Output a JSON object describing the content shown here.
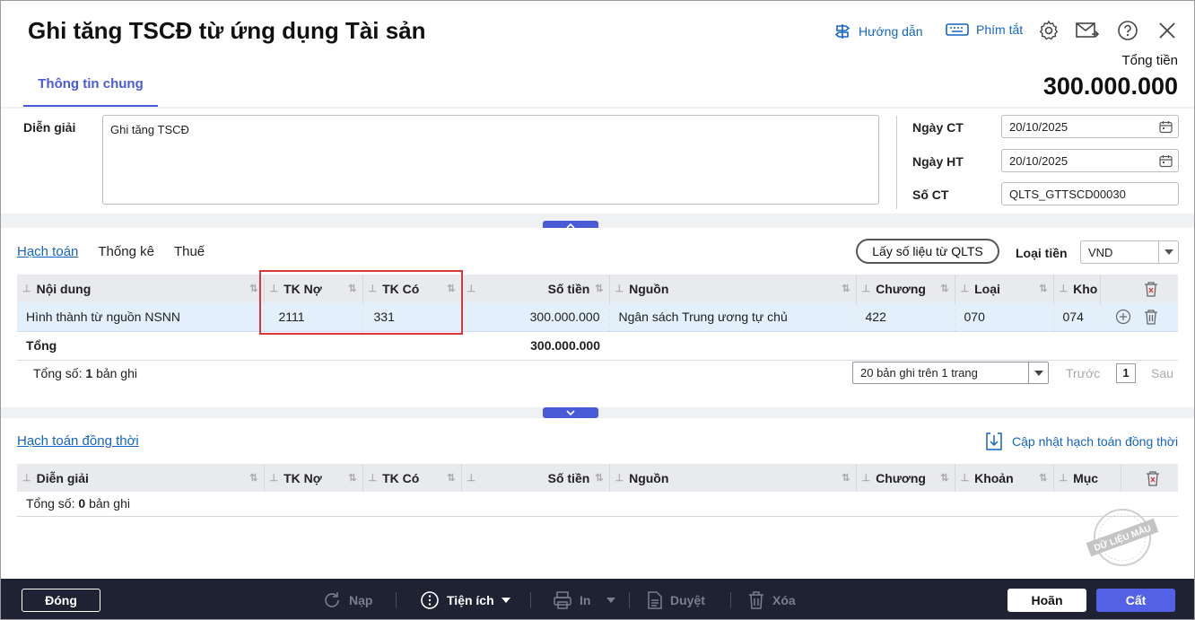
{
  "header": {
    "title": "Ghi tăng TSCĐ từ ứng dụng Tài sản",
    "guide_label": "Hướng dẫn",
    "shortcut_label": "Phím tắt",
    "total_label": "Tổng tiền",
    "total_value": "300.000.000",
    "tab_label": "Thông tin chung"
  },
  "form": {
    "description_label": "Diễn giải",
    "description_value": "Ghi tăng TSCĐ",
    "date_ct_label": "Ngày CT",
    "date_ct_value": "20/10/2025",
    "date_ht_label": "Ngày HT",
    "date_ht_value": "20/10/2025",
    "so_ct_label": "Số CT",
    "so_ct_value": "QLTS_GTTSCD00030"
  },
  "accounting": {
    "tabs": [
      "Hạch toán",
      "Thống kê",
      "Thuế"
    ],
    "fetch_button": "Lấy số liệu từ QLTS",
    "currency_label": "Loại tiền",
    "currency_value": "VND",
    "columns": [
      "Nội dung",
      "TK Nợ",
      "TK Có",
      "Số tiền",
      "Nguồn",
      "Chương",
      "Loại",
      "Kho"
    ],
    "rows": [
      {
        "noi_dung": "Hình thành từ nguồn NSNN",
        "tk_no": "2111",
        "tk_co": "331",
        "so_tien": "300.000.000",
        "nguon": "Ngân sách Trung ương tự chủ",
        "chuong": "422",
        "loai": "070",
        "kho": "074"
      }
    ],
    "total_label": "Tổng",
    "total_amount": "300.000.000",
    "record_count_prefix": "Tổng số:",
    "record_count": "1",
    "record_count_suffix": "bản ghi",
    "pager_select": "20 bản ghi trên 1 trang",
    "prev_label": "Trước",
    "page": "1",
    "next_label": "Sau"
  },
  "sync": {
    "title": "Hạch toán đồng thời",
    "update_link": "Cập nhật hạch toán đồng thời",
    "columns": [
      "Diễn giải",
      "TK Nợ",
      "TK Có",
      "Số tiền",
      "Nguồn",
      "Chương",
      "Khoản",
      "Mục"
    ],
    "record_count_prefix": "Tổng số:",
    "record_count": "0",
    "record_count_suffix": "bản ghi"
  },
  "watermark_text": "DỮ LIỆU MẪU",
  "toolbar": {
    "close": "Đóng",
    "reload": "Nạp",
    "utilities": "Tiện ích",
    "print": "In",
    "approve": "Duyệt",
    "delete": "Xóa",
    "cancel": "Hoãn",
    "save": "Cất"
  },
  "colors": {
    "accent": "#4a5bd8",
    "link": "#1565c0",
    "highlight_border": "#d9373b",
    "bottom_bar": "#1f2233"
  }
}
